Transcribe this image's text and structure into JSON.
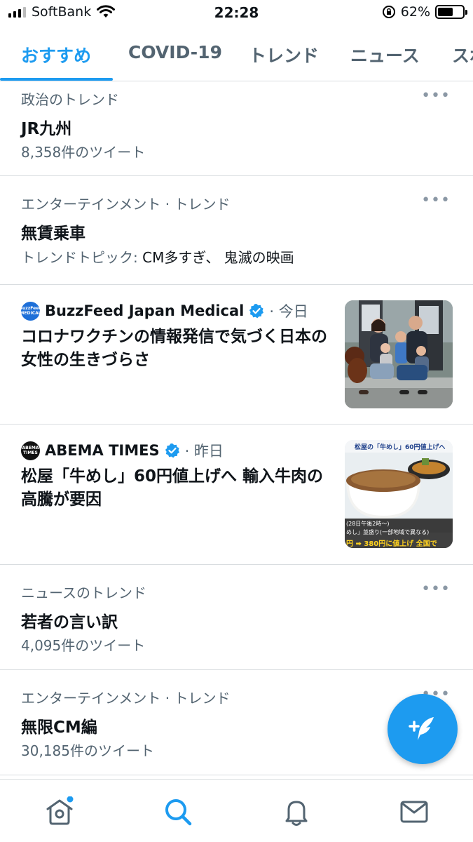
{
  "status_bar": {
    "carrier": "SoftBank",
    "time": "22:28",
    "battery": "62%",
    "battery_level": 0.62,
    "icons": [
      "cellular-signal-icon",
      "wifi-icon",
      "orientation-lock-icon",
      "battery-icon"
    ]
  },
  "tabs": [
    {
      "label": "おすすめ",
      "active": true
    },
    {
      "label": "COVID-19",
      "active": false
    },
    {
      "label": "トレンド",
      "active": false
    },
    {
      "label": "ニュース",
      "active": false
    },
    {
      "label": "スポ",
      "active": false
    }
  ],
  "feed": {
    "trend_1": {
      "category": "政治のトレンド",
      "name": "JR九州",
      "meta": "8,358件のツイート"
    },
    "trend_2": {
      "category": "エンターテインメント · トレンド",
      "name": "無賃乗車",
      "meta_prefix": "トレンドトピック: ",
      "meta_topics": "CM多すぎ、 鬼滅の映画"
    },
    "news_1": {
      "source": "BuzzFeed Japan Medical",
      "time": "· 今日",
      "title": "コロナワクチンの情報発信で気づく日本の女性の生きづらさ",
      "logo_text": "BuzzFeed MEDICAL"
    },
    "news_2": {
      "source": "ABEMA TIMES",
      "time": "· 昨日",
      "title": "松屋「牛めし」60円値上げへ 輸入牛肉の高騰が要因",
      "logo_text": "ABEMA TIMES",
      "thumb_caption": "松屋の「牛めし」60円値上げへ",
      "thumb_sub1": "(28日午後2時〜)",
      "thumb_sub2": "めし」並盛り(一部地域で異なる)",
      "thumb_sub3": "円 ➡ 380円に値上げ 全国で"
    },
    "trend_3": {
      "category": "ニュースのトレンド",
      "name": "若者の言い訳",
      "meta": "4,095件のツイート"
    },
    "trend_4": {
      "category": "エンターテインメント · トレンド",
      "name": "無限CM編",
      "meta": "30,185件のツイート"
    }
  },
  "more_label": "•••",
  "icons": {
    "fab": "compose-tweet-icon",
    "nav": [
      "home-icon",
      "search-icon",
      "notifications-bell-icon",
      "messages-envelope-icon"
    ]
  },
  "colors": {
    "accent": "#1d9bf0",
    "secondary_text": "#536471",
    "divider": "#d9dde0"
  }
}
